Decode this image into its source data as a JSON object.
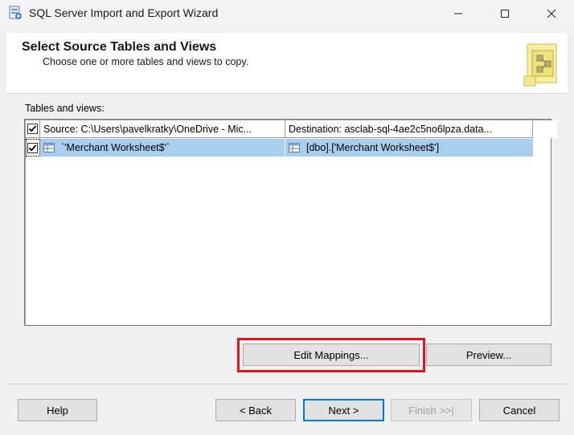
{
  "window": {
    "title": "SQL Server Import and Export Wizard"
  },
  "header": {
    "title": "Select Source Tables and Views",
    "subtitle": "Choose one or more tables and views to copy."
  },
  "tables": {
    "label": "Tables and views:",
    "columns": {
      "source": "Source: C:\\Users\\pavelkratky\\OneDrive - Mic...",
      "destination": "Destination: asclab-sql-4ae2c5no6lpza.data..."
    },
    "header_checked": true,
    "rows": [
      {
        "checked": true,
        "source": "`'Merchant Worksheet$'`",
        "destination": "[dbo].['Merchant Worksheet$']"
      }
    ]
  },
  "buttons": {
    "edit_mappings": "Edit Mappings...",
    "preview": "Preview...",
    "help": "Help",
    "back": "< Back",
    "next": "Next >",
    "finish": "Finish >>|",
    "cancel": "Cancel"
  },
  "colors": {
    "highlight": "#e0161e",
    "selection": "#a8d0ee",
    "focus": "#0078d7"
  }
}
